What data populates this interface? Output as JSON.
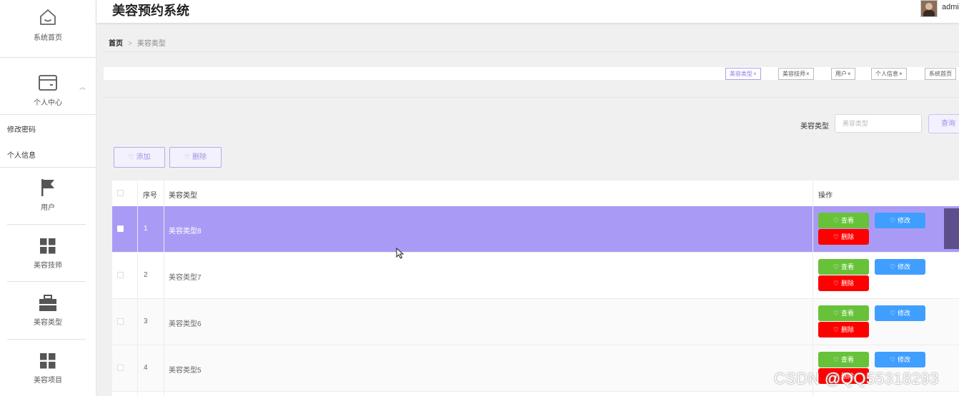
{
  "header": {
    "title": "美容预约系统",
    "user_name": "admi"
  },
  "sidebar": {
    "home_label": "系统首页",
    "personal_center_label": "个人中心",
    "change_password_label": "修改密码",
    "personal_info_label": "个人信息",
    "user_label": "用户",
    "technician_label": "美容技师",
    "beauty_type_label": "美容类型",
    "beauty_project_label": "美容项目"
  },
  "breadcrumb": {
    "home": "首页",
    "separator": ">",
    "current": "美容类型"
  },
  "tags": [
    {
      "label": "美容类型",
      "close": "×"
    },
    {
      "label": "美容技师",
      "close": "×"
    },
    {
      "label": "用户",
      "close": "×"
    },
    {
      "label": "个人信息",
      "close": "×"
    },
    {
      "label": "系统首页"
    }
  ],
  "search": {
    "label": "美容类型",
    "placeholder": "美容类型",
    "button": "查询"
  },
  "actions": {
    "add": "添加",
    "delete": "删除"
  },
  "table": {
    "headers": {
      "index": "序号",
      "type": "美容类型",
      "ops": "操作"
    },
    "rows": [
      {
        "index": "1",
        "type": "美容类型8"
      },
      {
        "index": "2",
        "type": "美容类型7"
      },
      {
        "index": "3",
        "type": "美容类型6"
      },
      {
        "index": "4",
        "type": "美容类型5"
      }
    ],
    "buttons": {
      "view": "查看",
      "edit": "修改",
      "delete": "删除"
    }
  },
  "watermark": "CSDN @QQ55318293",
  "colors": {
    "selected_row": "#a99bf5",
    "view": "#67c23a",
    "edit": "#409eff",
    "delete": "#ff0000",
    "accent": "#8a7ce6"
  }
}
